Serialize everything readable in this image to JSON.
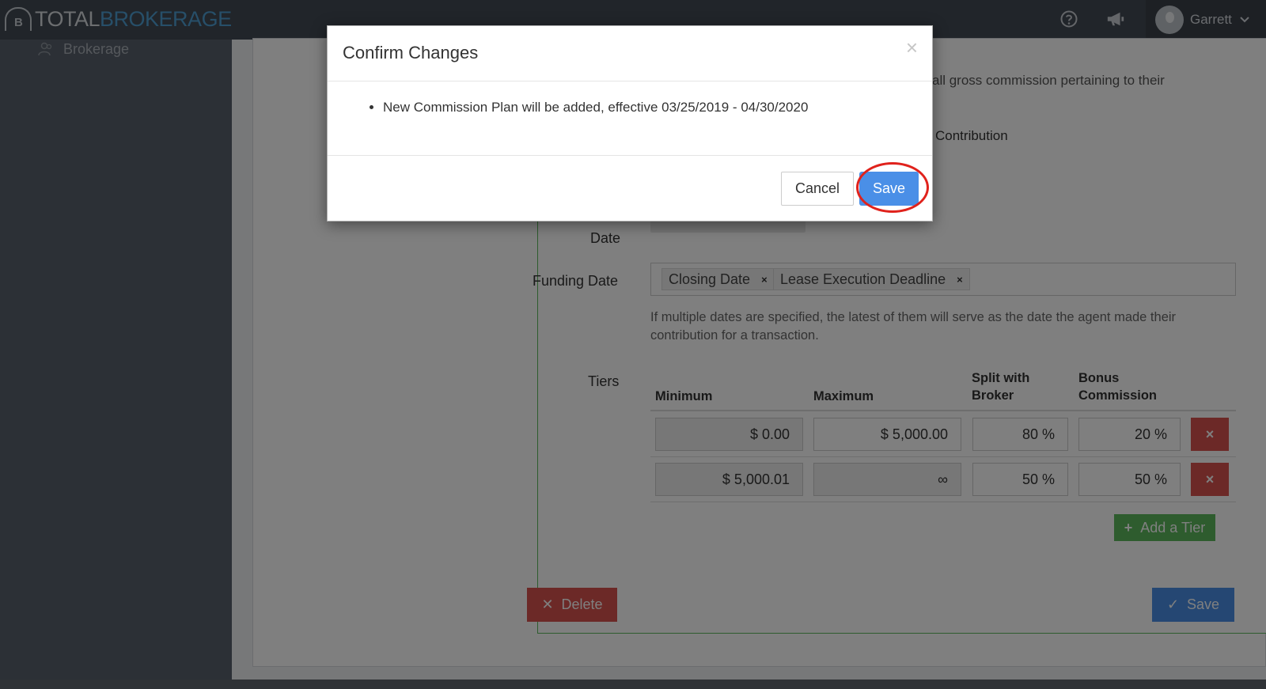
{
  "app": {
    "logo_total": "TOTAL",
    "logo_brokerage": "BROKERAGE",
    "logo_mark": "B",
    "user_name": "Garrett",
    "icons": [
      "help-icon",
      "megaphone-icon",
      "chevron-down-icon"
    ]
  },
  "sidebar": {
    "items": [
      {
        "label": "Brokerage",
        "icon": "users-icon"
      }
    ]
  },
  "form": {
    "gross_text": "all gross commission pertaining to their",
    "contribution_text": "Contribution",
    "date_label": "Date",
    "funding_label": "Funding Date",
    "tags": [
      {
        "label": "Closing Date"
      },
      {
        "label": "Lease Execution Deadline"
      }
    ],
    "tag_remove": "×",
    "help_text": "If multiple dates are specified, the latest of them will serve as the date the agent made their contribution for a transaction.",
    "tiers_label": "Tiers",
    "columns": {
      "minimum": "Minimum",
      "maximum": "Maximum",
      "split_line1": "Split with",
      "split_line2": "Broker",
      "bonus_line1": "Bonus",
      "bonus_line2": "Commission"
    },
    "rows": [
      {
        "minimum": "$ 0.00",
        "maximum": "$ 5,000.00",
        "split": "80 %",
        "bonus": "20 %"
      },
      {
        "minimum": "$ 5,000.01",
        "maximum": "∞",
        "split": "50 %",
        "bonus": "50 %"
      }
    ],
    "row_delete": "×",
    "add_tier": "Add a Tier",
    "delete": "Delete",
    "save": "Save",
    "colors": {
      "green": "#5cb85c",
      "red": "#d9534f",
      "blue": "#4a8fe7"
    }
  },
  "modal": {
    "title": "Confirm Changes",
    "close": "×",
    "items": [
      "New Commission Plan will be added, effective 03/25/2019 - 04/30/2020"
    ],
    "cancel": "Cancel",
    "save": "Save"
  }
}
